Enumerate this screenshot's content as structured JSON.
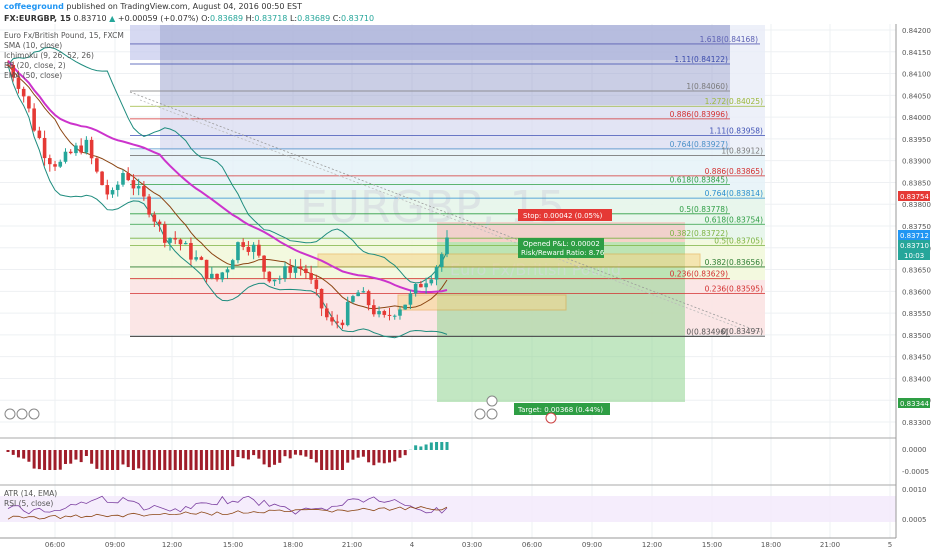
{
  "header": {
    "author": "coffeeground",
    "published": "published on TradingView.com, August 04, 2016 00:50 EST",
    "symbol": "FX:EURGBP, 15",
    "last": "0.83710",
    "change": "+0.00059 (+0.07%)",
    "o_label": "O:",
    "o": "0.83689",
    "h_label": "H:",
    "h": "0.83718",
    "l_label": "L:",
    "l": "0.83689",
    "c_label": "C:",
    "c": "0.83710"
  },
  "indicators": {
    "title": "Euro Fx/British Pound, 15, FXCM",
    "sma": "SMA (10, close)",
    "ichimoku": "Ichimoku (9, 26, 52, 26)",
    "bb": "BB (20, close, 2)",
    "ema": "EMA (50, close)",
    "atr": "ATR (14, EMA)",
    "rsi": "RSI (5, close)"
  },
  "watermark": "EURGBP, 15",
  "watermark_sub": "Euro Fx/British Pound",
  "fib_labels": [
    "1.618(0.84168)",
    "1.11(0.84122)",
    "1(0.84060)",
    "1.272(0.84025)",
    "0.886(0.83996)",
    "1.11(0.83958)",
    "0.764(0.83927)",
    "1(0.83912)",
    "0.886(0.83865)",
    "0.618(0.83845)",
    "0.764(0.83814)",
    "0.5(0.83778)",
    "0.618(0.83754)",
    "0.382(0.83722)",
    "0.5(0.83705)",
    "0.382(0.83656)",
    "0.236(0.83629)",
    "0.236(0.83595)",
    "0(0.83496)",
    "0(0.83497)"
  ],
  "position": {
    "stop": "Stop: 0.00042 (0.05%)",
    "opened": "Opened P&L: 0.00002",
    "rr": "Risk/Reward Ratio: 8.76",
    "target": "Target: 0.00368 (0.44%)"
  },
  "price_axis": {
    "ticks": [
      "0.84200",
      "0.84150",
      "0.84100",
      "0.84050",
      "0.84000",
      "0.83950",
      "0.83900",
      "0.83850",
      "0.83800",
      "0.83750",
      "0.83700",
      "0.83650",
      "0.83600",
      "0.83550",
      "0.83500",
      "0.83450",
      "0.83400",
      "0.83350",
      "0.83300"
    ],
    "badge_stop": "0.83754",
    "badge_last": "0.83712",
    "badge_last2": "0.83710",
    "badge_time": "10:03",
    "badge_target": "0.83344"
  },
  "macd_axis": [
    "0.0000",
    "-0.0005"
  ],
  "rsi_axis": [
    "0.0010",
    "0.0005"
  ],
  "time_axis": [
    "06:00",
    "09:00",
    "12:00",
    "15:00",
    "18:00",
    "21:00",
    "4",
    "03:00",
    "06:00",
    "09:00",
    "12:00",
    "15:00",
    "18:00",
    "21:00",
    "5"
  ],
  "colors": {
    "up": "#26a69a",
    "down": "#ef5350",
    "candle_up": "#26a69a",
    "candle_down": "#e53935",
    "ema": "#cc33cc",
    "sma": "#8b4513",
    "bb": "#1e8c7e",
    "profit": "#4caf50",
    "loss": "#f44336"
  },
  "chart_data": {
    "type": "candlestick",
    "symbol": "EURGBP",
    "interval": "15",
    "y_axis_range": [
      0.8327,
      0.8421
    ],
    "approx_close_path": [
      0.8412,
      0.8407,
      0.8398,
      0.8391,
      0.8389,
      0.8392,
      0.8394,
      0.8386,
      0.8381,
      0.8388,
      0.8383,
      0.8379,
      0.8373,
      0.8372,
      0.8369,
      0.8366,
      0.8362,
      0.8366,
      0.8372,
      0.837,
      0.8364,
      0.8363,
      0.8366,
      0.8365,
      0.8358,
      0.8352,
      0.8354,
      0.836,
      0.8357,
      0.8353,
      0.8356,
      0.8358,
      0.8362,
      0.8365,
      0.8371
    ],
    "last_close": 0.8371,
    "stop_level": 0.83754,
    "target_level": 0.83344
  }
}
